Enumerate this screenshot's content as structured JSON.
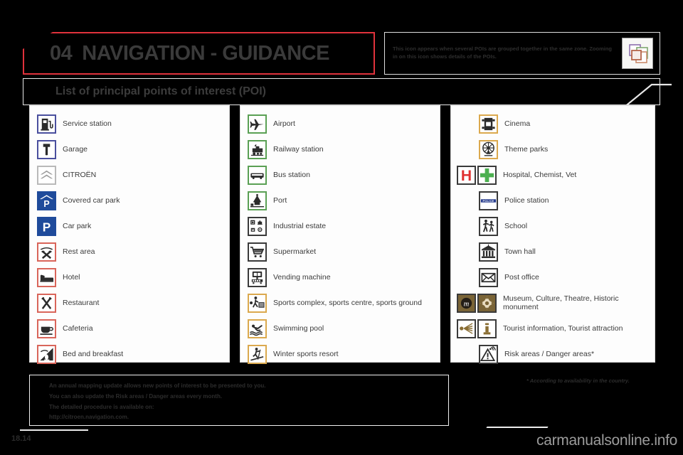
{
  "header": {
    "chapter_number": "04",
    "chapter_title": "NAVIGATION - GUIDANCE",
    "accent_color": "#e0323c",
    "note": {
      "text": "This icon appears when several POIs are grouped together in the same zone. Zooming in on this icon shows details of the POIs.",
      "icon_name": "grouped-poi-icon"
    }
  },
  "section": {
    "title": "List of principal points of interest (POI)"
  },
  "columns": [
    {
      "id": "column-1",
      "items": [
        {
          "label": "Service station",
          "icons": [
            "fuel-pump-icon"
          ],
          "border": "#4a4f9e"
        },
        {
          "label": "Garage",
          "icons": [
            "spanner-icon"
          ],
          "border": "#4a4f9e"
        },
        {
          "label": "CITROËN",
          "icons": [
            "citroen-chevrons-icon"
          ],
          "border": "#b9b9b9"
        },
        {
          "label": "Covered car park",
          "icons": [
            "covered-parking-icon"
          ],
          "border": "#1f4b9b"
        },
        {
          "label": "Car park",
          "icons": [
            "parking-icon"
          ],
          "border": "#1f4b9b"
        },
        {
          "label": "Rest area",
          "icons": [
            "rest-area-icon"
          ],
          "border": "#d9655a"
        },
        {
          "label": "Hotel",
          "icons": [
            "bed-icon"
          ],
          "border": "#d9655a"
        },
        {
          "label": "Restaurant",
          "icons": [
            "cutlery-icon"
          ],
          "border": "#d9655a"
        },
        {
          "label": "Cafeteria",
          "icons": [
            "coffee-cup-icon"
          ],
          "border": "#d9655a"
        },
        {
          "label": "Bed and breakfast",
          "icons": [
            "bed-and-breakfast-icon"
          ],
          "border": "#d9655a"
        }
      ]
    },
    {
      "id": "column-2",
      "items": [
        {
          "label": "Airport",
          "icons": [
            "airplane-icon"
          ],
          "border": "#5aa054"
        },
        {
          "label": "Railway station",
          "icons": [
            "train-icon"
          ],
          "border": "#5aa054"
        },
        {
          "label": "Bus station",
          "icons": [
            "bus-icon"
          ],
          "border": "#5aa054"
        },
        {
          "label": "Port",
          "icons": [
            "port-icon"
          ],
          "border": "#5aa054"
        },
        {
          "label": "Industrial estate",
          "icons": [
            "industrial-estate-icon"
          ],
          "border": "#3a3a3a"
        },
        {
          "label": "Supermarket",
          "icons": [
            "shopping-trolley-icon"
          ],
          "border": "#3a3a3a"
        },
        {
          "label": "Vending machine",
          "icons": [
            "vending-machine-icon"
          ],
          "border": "#3a3a3a"
        },
        {
          "label": "Sports complex, sports centre, sports ground",
          "icons": [
            "sports-complex-icon"
          ],
          "border": "#dba94e"
        },
        {
          "label": "Swimming pool",
          "icons": [
            "swimmer-icon"
          ],
          "border": "#dba94e"
        },
        {
          "label": "Winter sports resort",
          "icons": [
            "skier-icon"
          ],
          "border": "#dba94e"
        }
      ]
    },
    {
      "id": "column-3",
      "items": [
        {
          "label": "Cinema",
          "icons": [
            "film-reel-icon"
          ],
          "border": "#dba94e",
          "indent": true
        },
        {
          "label": "Theme parks",
          "icons": [
            "ferris-wheel-icon"
          ],
          "border": "#dba94e",
          "indent": true
        },
        {
          "label": "Hospital, Chemist, Vet",
          "icons": [
            "hospital-h-icon",
            "green-cross-icon"
          ],
          "border": "#3a3a3a",
          "indent": false
        },
        {
          "label": "Police station",
          "icons": [
            "police-icon"
          ],
          "border": "#3a3a3a",
          "indent": true
        },
        {
          "label": "School",
          "icons": [
            "school-children-icon"
          ],
          "border": "#3a3a3a",
          "indent": true
        },
        {
          "label": "Town hall",
          "icons": [
            "town-hall-icon"
          ],
          "border": "#3a3a3a",
          "indent": true
        },
        {
          "label": "Post office",
          "icons": [
            "envelope-icon"
          ],
          "border": "#3a3a3a",
          "indent": true
        },
        {
          "label": "Museum, Culture, Theatre, Historic monument",
          "icons": [
            "museum-m-icon",
            "historic-monument-icon"
          ],
          "border": "#3a3a3a",
          "indent": false
        },
        {
          "label": "Tourist information, Tourist attraction",
          "icons": [
            "tourist-attraction-icon",
            "tourist-information-icon"
          ],
          "border": "#3a3a3a",
          "indent": false
        },
        {
          "label": "Risk areas / Danger areas*",
          "icons": [
            "risk-area-warning-icon"
          ],
          "border": "#3a3a3a",
          "indent": true
        }
      ]
    }
  ],
  "footer": {
    "lines": [
      "An annual mapping update allows new points of interest to be presented to you.",
      "You can also update the Risk areas / Danger areas every month.",
      "The detailed procedure is available on:",
      "http://citroen.navigation.com."
    ],
    "availability_note": "* According to availability in the country.",
    "page_number": "18.14",
    "watermark": "carmanualsonline.info"
  }
}
